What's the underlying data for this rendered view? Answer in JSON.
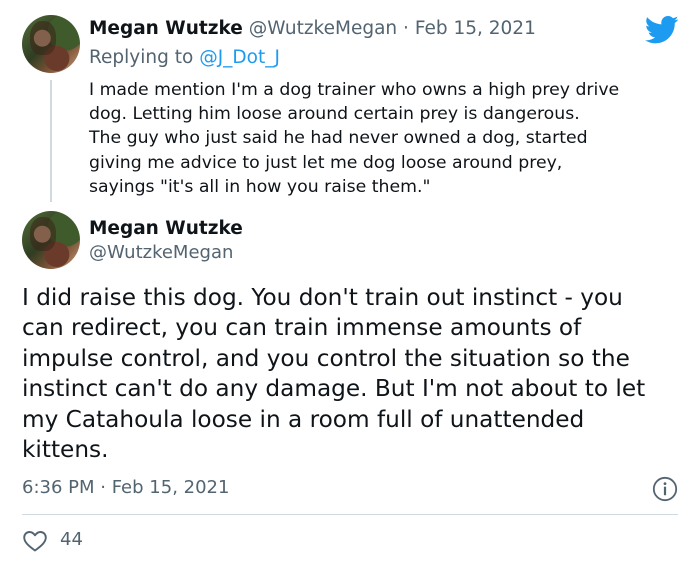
{
  "reply_tweet": {
    "author_name": "Megan Wutzke",
    "author_handle": "@WutzkeMegan",
    "separator": "·",
    "date": "Feb 15, 2021",
    "replying_prefix": "Replying to",
    "replying_to": "@J_Dot_J",
    "text_lines": [
      "I made mention I'm a dog trainer who owns a high prey drive",
      "dog. Letting him loose around certain prey is dangerous.",
      "The guy who just said he had never owned a dog, started",
      "giving me advice to just let me dog loose around prey,",
      "sayings \"it's all in how you raise them.\""
    ]
  },
  "main_tweet": {
    "author_name": "Megan Wutzke",
    "author_handle": "@WutzkeMegan",
    "text_lines": [
      "I did raise this dog. You don't train out instinct - you",
      "can redirect, you can train immense amounts of",
      "impulse control, and you control the situation so the",
      "instinct can't do any damage. But I'm not about to let",
      "my Catahoula loose in a room full of unattended",
      "kittens."
    ],
    "timestamp": "6:36 PM · Feb 15, 2021",
    "like_count": "44"
  },
  "icons": {
    "brand": "twitter-bird-icon",
    "info": "info-icon",
    "like": "heart-icon"
  },
  "colors": {
    "accent": "#1d9bf0",
    "muted_text": "#536471",
    "divider": "#cfd9de"
  }
}
